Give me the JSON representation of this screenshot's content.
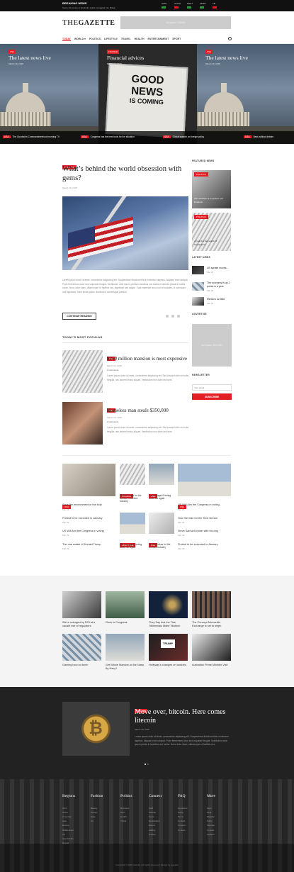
{
  "topbar": {
    "breaking_label": "BREAKING NEWS",
    "breaking_text": "Some 40 tonnes of alcoholic spirits smuggled into Britain",
    "tickers": [
      {
        "name": "AAPL",
        "value": "+0.0%",
        "color": "#2a9d3c"
      },
      {
        "name": "GOOG",
        "value": "-0.0%",
        "color": "#e31e24"
      },
      {
        "name": "MSFT",
        "value": "+0.0%",
        "color": "#2a9d3c"
      },
      {
        "name": "AMZN",
        "value": "+0.0%",
        "color": "#2a9d3c"
      },
      {
        "name": "FB",
        "value": "-0.0%",
        "color": "#e31e24"
      }
    ]
  },
  "header": {
    "logo_the": "THE",
    "logo_name": "GAZETTE",
    "ad_label": "Ad space 728x90"
  },
  "nav": {
    "items": [
      "TODAY",
      "WORLD ▾",
      "POLITICS",
      "LIFESTYLE",
      "TRAVEL",
      "HEALTH",
      "ENTERTAINMENT",
      "SPORT"
    ]
  },
  "slider": {
    "slides": [
      {
        "tag": "USA",
        "title": "The latest news live",
        "date": "March 29, 2018"
      },
      {
        "tag": "FINANCE",
        "title": "Financial advices",
        "date": "March 29, 2018"
      },
      {
        "tag": "USA",
        "title": "The latest news live",
        "date": "March 29, 2018"
      }
    ],
    "sign": {
      "line1": "GOOD",
      "line2": "NEWS",
      "line3": "IS COMING"
    },
    "ticker": [
      {
        "tag": "USA",
        "text": "The Goodwin’s Commandments at morning TV"
      },
      {
        "tag": "USA",
        "text": "Congress has the best tools for the situation"
      },
      {
        "tag": "USA",
        "text": "Global speech on foreign policy"
      },
      {
        "tag": "USA",
        "text": "Best political debate"
      }
    ]
  },
  "main": {
    "tag": "POLITICS",
    "title": "What’s behind the world obsession with gems?",
    "date": "March 29, 2018",
    "body": "Lorem ipsum dolor sit amet, consectetur adipiscing elit. Suspendisse tincidunt felis et interdum dapibus. Aliquam erat volutpat. Proin fermentum dolor sed vulputate feugiat. Vestibulum ante ipsum primis in faucibus orci luctus et ultrices posuere cubilia curae. Nunc dolor diam, ullamcorper ut facilisis nec, dignissim sed augue. Cras imperdiet arcu non mi sodales, id commodo orci dignissim. Nam lectus purus, tincidunt a scelerisque pretium.",
    "continue": "CONTINUE READING"
  },
  "popular": {
    "heading": "TODAY’S MOST POPULAR",
    "items": [
      {
        "tag": "USA",
        "title": "$250 million mansion is most expensive",
        "date": "March 29, 2018",
        "comments": "2 comments",
        "excerpt": "Lorem ipsum dolor sit amet, consectetur adipiscing elit. Sed suscipit nibh vel nulla fringilla, nec laoreet lectus aliquet. Vestibulum non diam sed sem."
      },
      {
        "tag": "USA",
        "title": "Homeless man steals $350,000",
        "date": "March 29, 2018",
        "comments": "2 comments",
        "excerpt": "Lorem ipsum dolor sit amet, consectetur adipiscing elit. Sed suscipit nibh vel nulla fringilla, nec laoreet lectus aliquet. Vestibulum non diam sed sem."
      }
    ]
  },
  "sidebar": {
    "featured_heading": "FEATURED NEWS",
    "featured": [
      {
        "tag": "POLITICS",
        "title": "Our decision is to protect our freedom"
      },
      {
        "tag": "POLITICS",
        "title": "A year for the world of newspapers"
      }
    ],
    "latest_heading": "LATEST NEWS",
    "latest": [
      {
        "title": "US senate moves...",
        "date": "Mar 29"
      },
      {
        "title": "The economy is up 2 points in a year",
        "date": "Mar 29"
      },
      {
        "title": "Media is so fake",
        "date": "Mar 29"
      }
    ],
    "ad_heading": "ADVERTISE",
    "ad_label": "Ad space 300x250",
    "newsletter_heading": "NEWSLETTER",
    "newsletter_placeholder": "Your email",
    "subscribe": "SUBSCRIBE"
  },
  "grid": {
    "cols": [
      {
        "big": {
          "tag": "USA",
          "title": "Save the environment or the ship",
          "date": "Mar 29"
        },
        "items": [
          {
            "title": "Protest to be executed in January",
            "date": "Mar 29"
          },
          {
            "title": "US Will Aim the Congress in voting",
            "date": "Mar 29"
          },
          {
            "title": "The real estate of Donald Trump",
            "date": "Mar 29"
          }
        ]
      },
      {
        "a": {
          "tag": "FINANCE",
          "title": "15 Bold Ideas for the Surface Incentive Industry",
          "date": "Mar 29"
        },
        "b": {
          "tag": "LIFESTYLE",
          "title": "Get Engaged Feeling about life again",
          "date": "Mar 29"
        }
      },
      {
        "a": {
          "tag": "USA",
          "title": "Get Engaged Feeling about life again",
          "date": "Mar 29"
        },
        "b": {
          "tag": "USA",
          "title": "21 Bold Ideas for the Surface Industry",
          "date": "Mar 29"
        }
      },
      {
        "big": {
          "tag": "USA",
          "title": "US Will Aim the Congress in voting",
          "date": "Mar 29"
        },
        "items": [
          {
            "title": "How the man for the Time Dream",
            "date": "Mar 29"
          },
          {
            "title": "Steve Samuel known with his dog",
            "date": "Mar 29"
          },
          {
            "title": "Protest to be executed in January",
            "date": "Mar 29"
          }
        ]
      }
    ]
  },
  "grey": {
    "items": [
      {
        "title": "We're outraged by ROI at a vacant rise of regulators"
      },
      {
        "title": "Guns in Congress"
      },
      {
        "title": "They Say that the Tide “Millennials Make” Biotech"
      },
      {
        "title": "The Concept Mercantile Exchange is set to begin"
      },
      {
        "title": "Gaming has not been"
      },
      {
        "title": "Get Whole Mansion at the Nasa By Navy?"
      },
      {
        "title": "Hollyway's changes on workers"
      },
      {
        "title": "Australian Prime Minister Visit"
      }
    ],
    "trump_sign": "TRUMP"
  },
  "feature": {
    "tag": "BITCOIN",
    "title": "Move over, bitcoin. Here comes litecoin",
    "date": "March 29, 2018",
    "body": "Lorem ipsum dolor sit amet, consectetur adipiscing elit. Suspendisse tincidunt felis et interdum dapibus. Aliquam erat volutpat. Proin fermentum dolor sed vulputate feugiat. Vestibulum ante ipsum primis in faucibus orci luctus. Nunc dolor diam, ullamcorper ut facilisis nec."
  },
  "footer": {
    "cols": [
      {
        "heading": "Regions",
        "links": [
          "USA",
          "Africa",
          "Americas",
          "Asia",
          "Europe",
          "Middle East",
          "UK",
          "Asia Pacific",
          "Russia"
        ]
      },
      {
        "heading": "Fashion",
        "links": [
          "Beauty",
          "Design",
          "Style",
          "Art"
        ]
      },
      {
        "heading": "Politics",
        "links": [
          "Business",
          "Tech",
          "Health",
          "Travel"
        ]
      },
      {
        "heading": "Connect",
        "links": [
          "Staff",
          "Awards",
          "Team",
          "Newsletters",
          "Events",
          "Adding",
          "Privacy"
        ]
      },
      {
        "heading": "FAQ",
        "links": [
          "Questions",
          "Policy",
          "Terms",
          "Contact",
          "Careers",
          "Contact"
        ]
      },
      {
        "heading": "More",
        "links": [
          "Sport",
          "Real",
          "Weather",
          "Policy",
          "Sitemap",
          "Contact",
          "Careers"
        ]
      }
    ],
    "copyright": "Copyright © 2018 Gazette | All rights reserved | Design by Gazette"
  }
}
